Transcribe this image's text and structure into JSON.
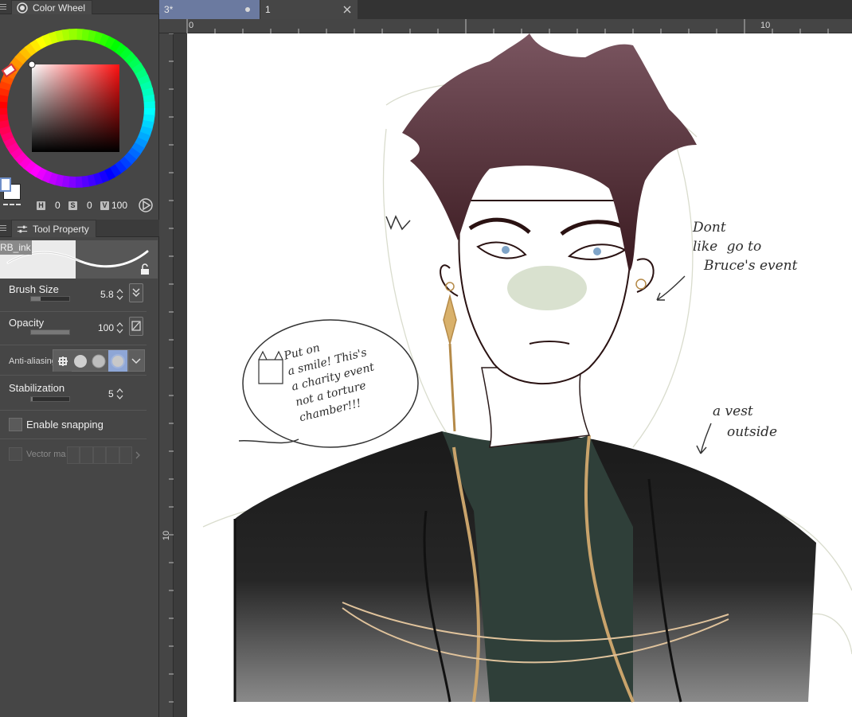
{
  "color_panel": {
    "tab_label": "Color Wheel",
    "hue_key": "H",
    "hue_value": "0",
    "sat_key": "S",
    "sat_value": "0",
    "val_key": "V",
    "val_value": "100",
    "accent": "#d8343a"
  },
  "tool_property": {
    "tab_label": "Tool Property",
    "brush_name": "RB_ink",
    "brush_size_label": "Brush Size",
    "brush_size_value": "5.8",
    "brush_size_fraction": 0.25,
    "opacity_label": "Opacity",
    "opacity_value": "100",
    "opacity_fraction": 1.0,
    "antialias_label": "Anti-aliasing",
    "stabilization_label": "Stabilization",
    "stabilization_value": "5",
    "stabilization_fraction": 0.05,
    "snapping_label": "Enable snapping",
    "vector_label": "Vector magnet"
  },
  "document_tabs": [
    {
      "label": "3*",
      "active": true
    },
    {
      "label": "1",
      "active": false
    }
  ],
  "ruler": {
    "top_marks": [
      "0",
      "10"
    ],
    "left_marks": [
      "10"
    ]
  },
  "canvas_notes": {
    "left_bubble": [
      "Put on",
      "a smile! This's",
      "a charity event",
      "not a torture",
      "chamber!!!"
    ],
    "right_note": [
      "Dont",
      "like",
      "go to",
      "Bruce's event"
    ],
    "vest_note": [
      "a vest",
      "outside"
    ]
  }
}
